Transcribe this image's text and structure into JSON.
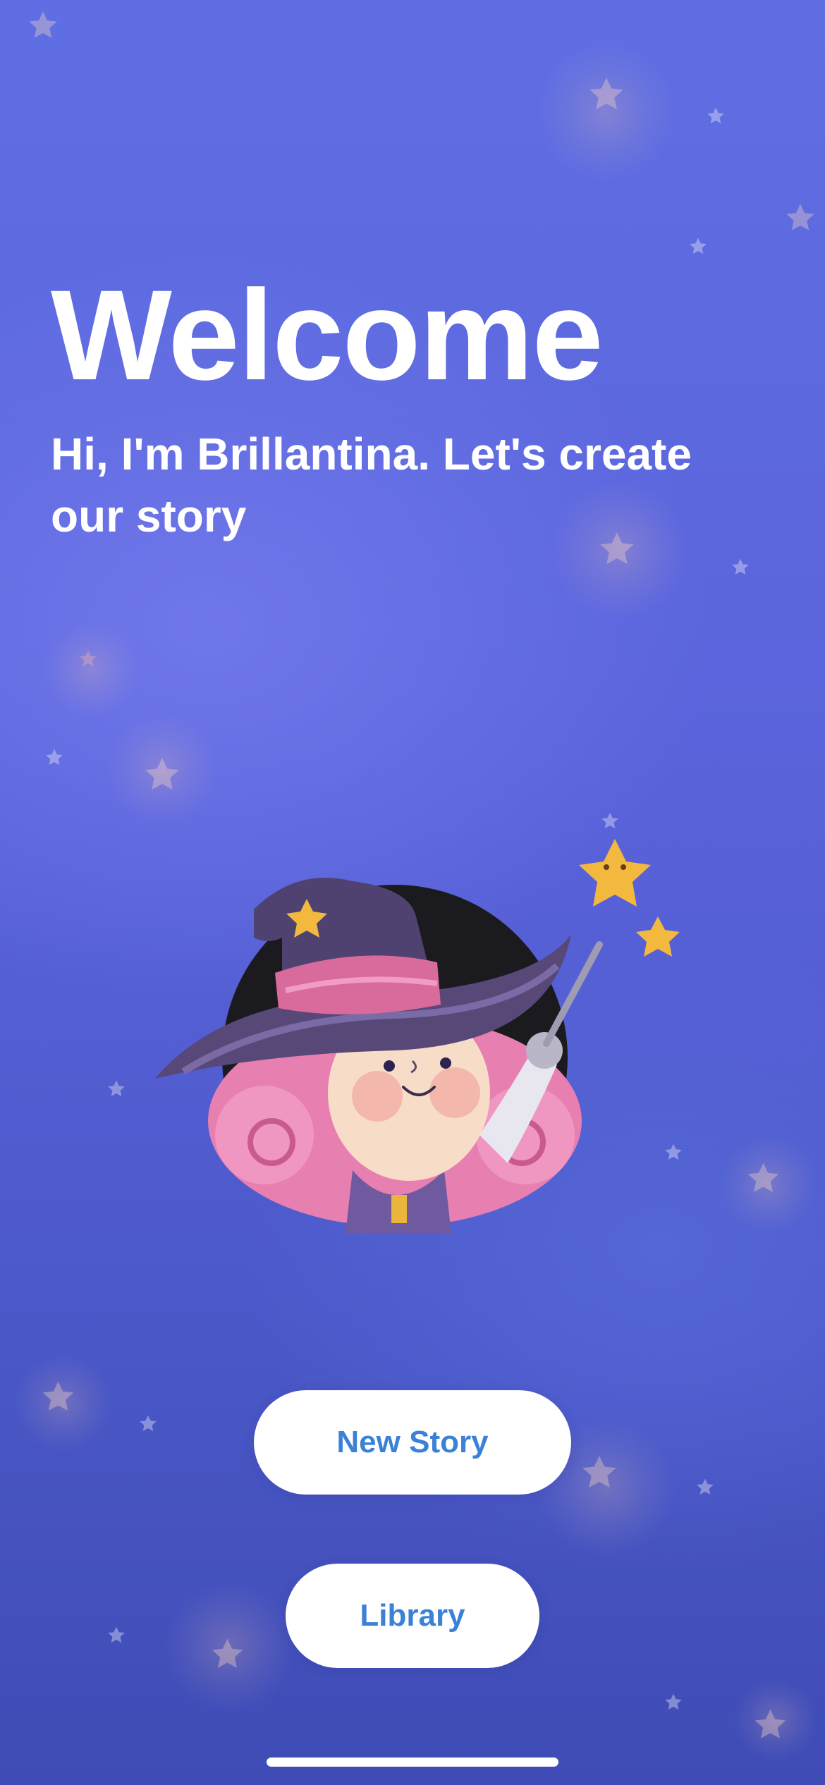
{
  "screen": {
    "title": "Welcome",
    "subtitle": "Hi, I'm Brillantina. Let's create our story"
  },
  "illustration": {
    "icon": "witch-illustration"
  },
  "buttons": {
    "new_story": "New Story",
    "library": "Library"
  },
  "colors": {
    "background_top": "#5f6fe3",
    "background_bottom": "#3f4cb6",
    "button_bg": "#ffffff",
    "button_text": "#3b82d6",
    "title_text": "#ffffff"
  }
}
